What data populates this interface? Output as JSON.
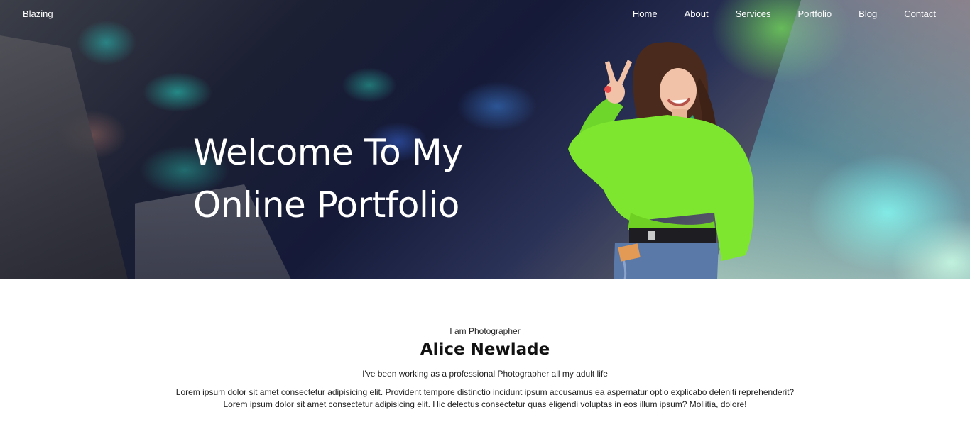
{
  "nav": {
    "brand": "Blazing",
    "links": [
      "Home",
      "About",
      "Services",
      "Portfolio",
      "Blog",
      "Contact"
    ]
  },
  "hero": {
    "title_line1": "Welcome To My",
    "title_line2": "Online Portfolio"
  },
  "about": {
    "role": "I am Photographer",
    "name": "Alice Newlade",
    "tagline": "I've been working as a professional Photographer all my adult life",
    "description_line1": "Lorem ipsum dolor sit amet consectetur adipisicing elit. Provident tempore distinctio incidunt ipsum accusamus ea aspernatur optio explicabo deleniti reprehenderit?",
    "description_line2": "Lorem ipsum dolor sit amet consectetur adipisicing elit. Hic delectus consectetur quas eligendi voluptas in eos illum ipsum? Mollitia, dolore!"
  },
  "colors": {
    "sweater": "#7ee62e",
    "text_on_hero": "#ffffff"
  }
}
